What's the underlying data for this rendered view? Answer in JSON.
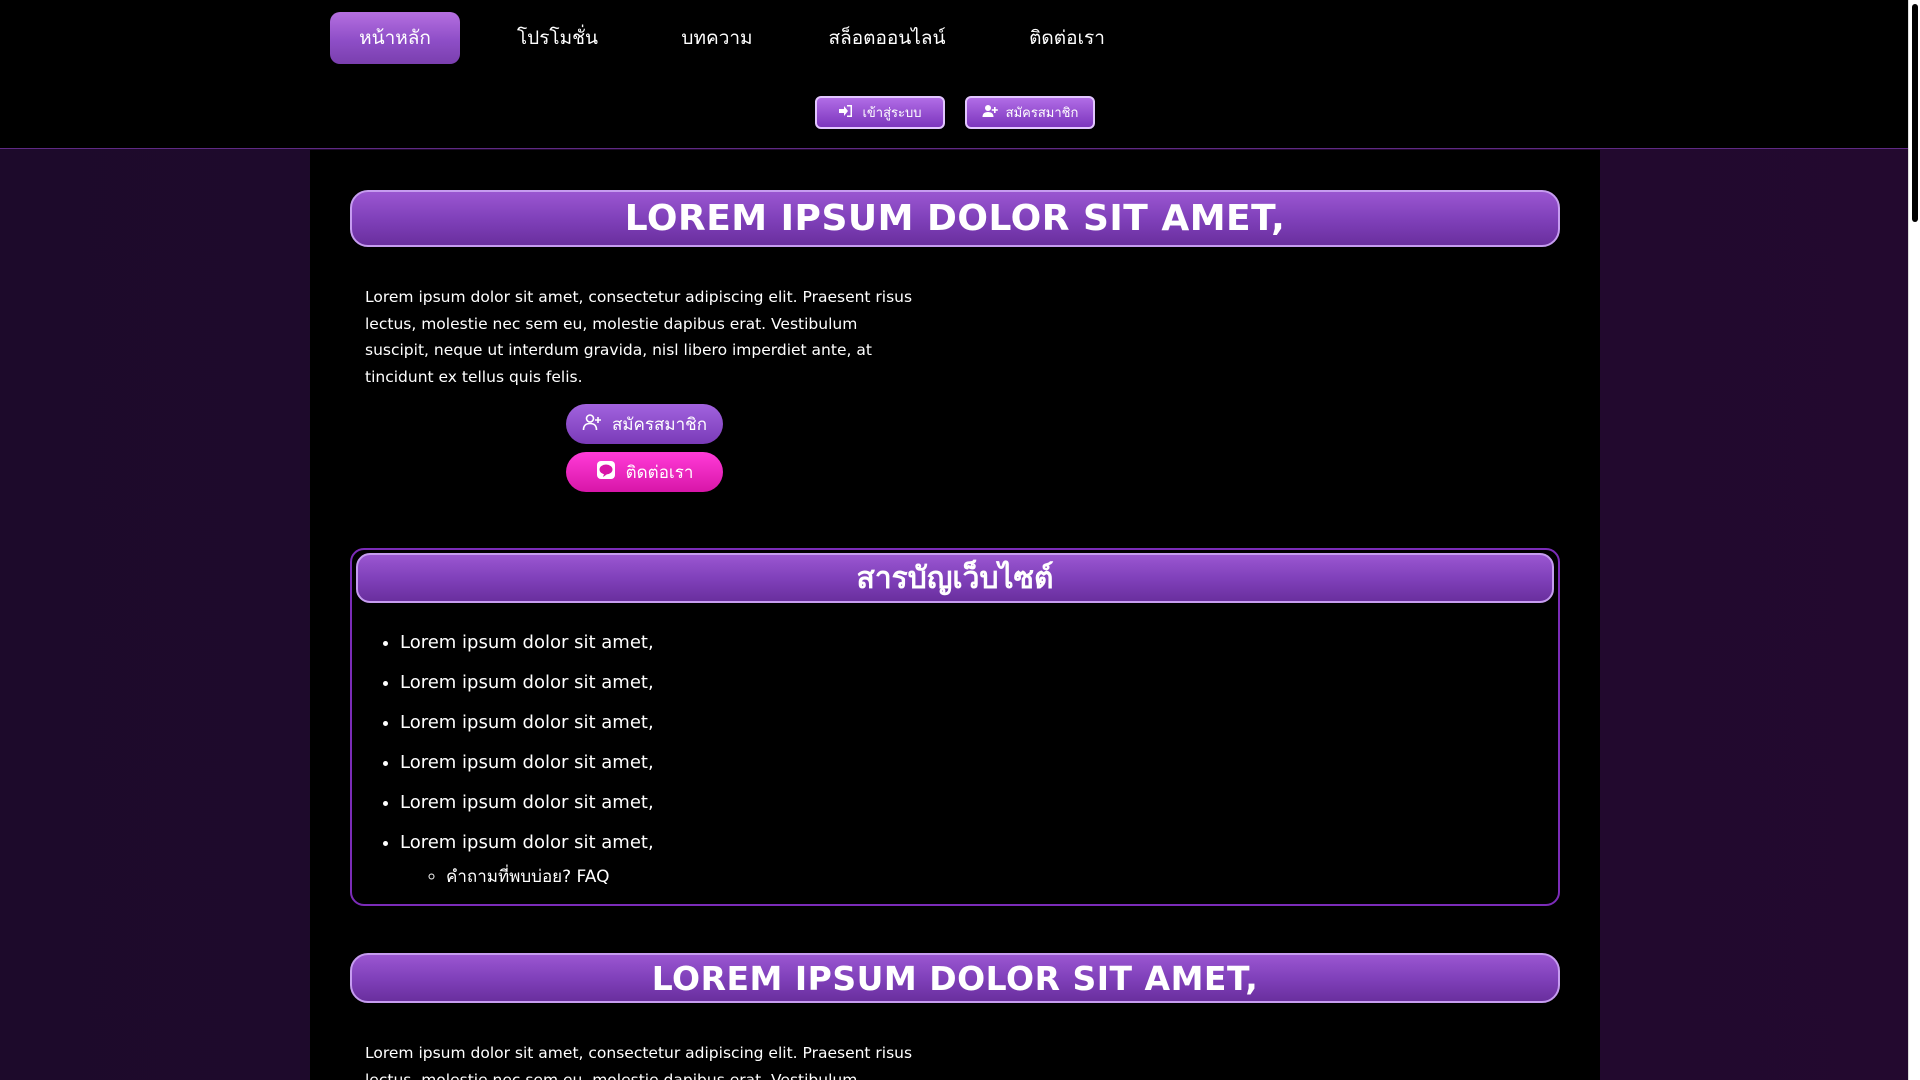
{
  "nav": {
    "items": [
      {
        "label": "หน้าหลัก"
      },
      {
        "label": "โปรโมชั่น"
      },
      {
        "label": "บทความ"
      },
      {
        "label": "สล็อตออนไลน์"
      },
      {
        "label": "ติดต่อเรา"
      }
    ],
    "active_index": 0
  },
  "auth": {
    "login_label": "เข้าสู่ระบบ",
    "register_label": "สมัครสมาชิก"
  },
  "main": {
    "section1": {
      "title": "LOREM IPSUM DOLOR SIT AMET,",
      "paragraph": "Lorem ipsum dolor sit amet, consectetur adipiscing elit. Praesent risus lectus, molestie nec sem eu, molestie dapibus erat. Vestibulum suscipit, neque ut interdum gravida, nisl libero imperdiet ante, at tincidunt ex tellus quis felis."
    },
    "cta": {
      "signup_label": "สมัครสมาชิก",
      "contact_label": "ติดต่อเรา"
    },
    "toc": {
      "title": "สารบัญเว็บไซต์",
      "items": [
        "Lorem ipsum dolor sit amet,",
        "Lorem ipsum dolor sit amet,",
        "Lorem ipsum dolor sit amet,",
        "Lorem ipsum dolor sit amet,",
        "Lorem ipsum dolor sit amet,",
        "Lorem ipsum dolor sit amet,"
      ],
      "subitem": "คำถามที่พบบ่อย? FAQ"
    },
    "section2": {
      "title": "LOREM IPSUM DOLOR SIT AMET,",
      "paragraph": "Lorem ipsum dolor sit amet, consectetur adipiscing elit. Praesent risus lectus, molestie nec sem eu, molestie dapibus erat. Vestibulum suscipit, neque ut"
    }
  },
  "colors": {
    "accent_purple": "#8e4ec7",
    "accent_pink": "#e21fb9",
    "background": "#000000"
  }
}
